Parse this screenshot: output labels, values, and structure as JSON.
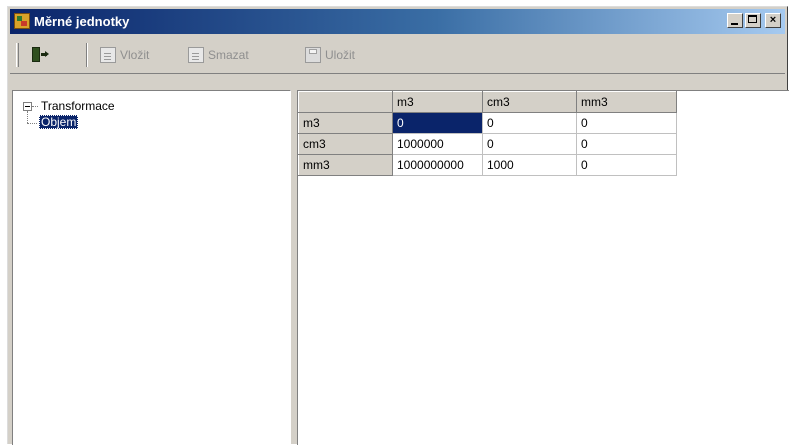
{
  "window": {
    "title": "Měrné jednotky",
    "controls": {
      "minimize": "minimize",
      "maximize": "maximize",
      "close": "×"
    }
  },
  "toolbar": {
    "exit_icon": "exit-door-icon",
    "insert_label": "Vložit",
    "delete_label": "Smazat",
    "save_label": "Uložit",
    "insert_enabled": false,
    "delete_enabled": false,
    "save_enabled": false
  },
  "tree": {
    "root": {
      "label": "Transformace",
      "expanded": true
    },
    "children": [
      {
        "label": "Objem",
        "selected": true
      }
    ]
  },
  "grid": {
    "columns": [
      "m3",
      "cm3",
      "mm3"
    ],
    "rows": [
      {
        "label": "m3",
        "cells": [
          "0",
          "0",
          "0"
        ]
      },
      {
        "label": "cm3",
        "cells": [
          "1000000",
          "0",
          "0"
        ]
      },
      {
        "label": "mm3",
        "cells": [
          "1000000000",
          "1000",
          "0"
        ]
      }
    ],
    "selected_cell": {
      "row": 0,
      "col": 0
    }
  },
  "colors": {
    "title_gradient_start": "#0a246a",
    "title_gradient_end": "#a6caf0",
    "selection": "#0a246a",
    "face": "#d4d0c8"
  }
}
